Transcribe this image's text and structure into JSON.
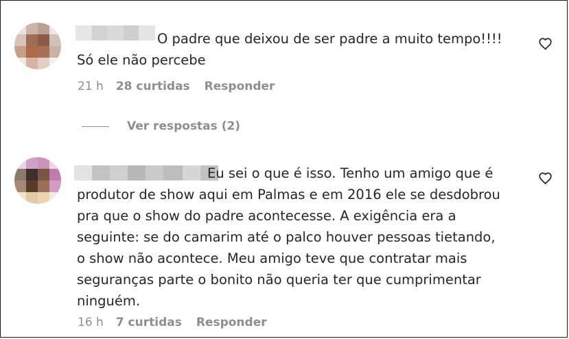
{
  "comments": [
    {
      "text_line1": "O padre que deixou de ser padre a muito tempo!!!!",
      "text_rest": "Só ele não percebe",
      "time": "21 h",
      "likes": "28 curtidas",
      "reply_label": "Responder"
    },
    {
      "text_line1": "Eu sei o que é isso. Tenho um amigo que é",
      "text_rest": "produtor de show aqui em Palmas e em 2016 ele se desdobrou\npra que o show do padre acontecesse. A exigência era a\nseguinte: se do camarim até o palco houver pessoas tietando,\no show não acontece. Meu amigo teve que contratar mais\nseguranças parte o bonito não queria ter que cumprimentar\nninguém.",
      "time": "16 h",
      "likes": "7 curtidas",
      "reply_label": "Responder"
    }
  ],
  "view_replies": "Ver respostas (2)",
  "icons": {
    "like": "heart-outline-icon"
  },
  "colors": {
    "text": "#262626",
    "muted": "#8e8e8e"
  }
}
